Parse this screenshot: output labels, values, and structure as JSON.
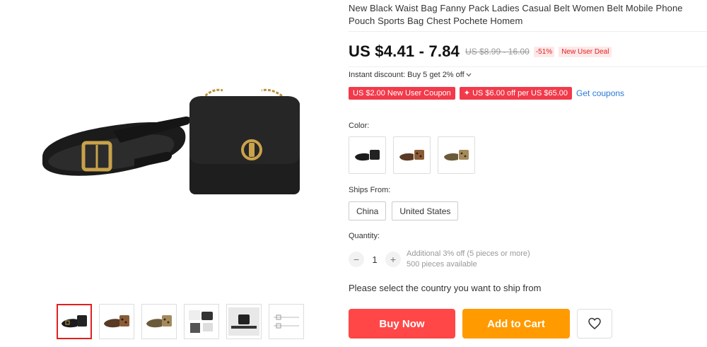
{
  "product": {
    "title": "New Black Waist Bag Fanny Pack Ladies Casual Belt Women Belt Mobile Phone Pouch Sports Bag Chest Pochete Homem",
    "price": "US $4.41 - 7.84",
    "original_price": "US $8.99 - 16.00",
    "discount": "-51%",
    "deal_tag": "New User Deal",
    "instant_discount": "Instant discount: Buy 5 get 2% off",
    "coupons": [
      "US $2.00 New User Coupon",
      "✦ US $6.00 off per US $65.00"
    ],
    "get_coupons": "Get coupons"
  },
  "options": {
    "color_label": "Color:",
    "colors": [
      "black",
      "leopard-brown",
      "leopard-tan"
    ],
    "ships_from_label": "Ships From:",
    "ships_from": [
      "China",
      "United States"
    ],
    "quantity_label": "Quantity:",
    "quantity": "1",
    "qty_minus": "−",
    "qty_plus": "+",
    "qty_note_1": "Additional 3% off (5 pieces or more)",
    "qty_note_2": "500 pieces available"
  },
  "shipping_prompt": "Please select the country you want to ship from",
  "actions": {
    "buy_now": "Buy Now",
    "add_to_cart": "Add to Cart"
  },
  "gallery": {
    "thumbnails": [
      "black-set",
      "brown-leopard",
      "tan-leopard",
      "lifestyle-flatlay",
      "model-photo",
      "sketch"
    ],
    "active_index": 0
  },
  "icons": {
    "wishlist": "heart-icon",
    "dropdown": "chevron-down-icon"
  },
  "colors": {
    "buy": "#ff4747",
    "cart": "#ff9a00",
    "coupon": "#f23a4a",
    "link": "#2a7ad6"
  }
}
